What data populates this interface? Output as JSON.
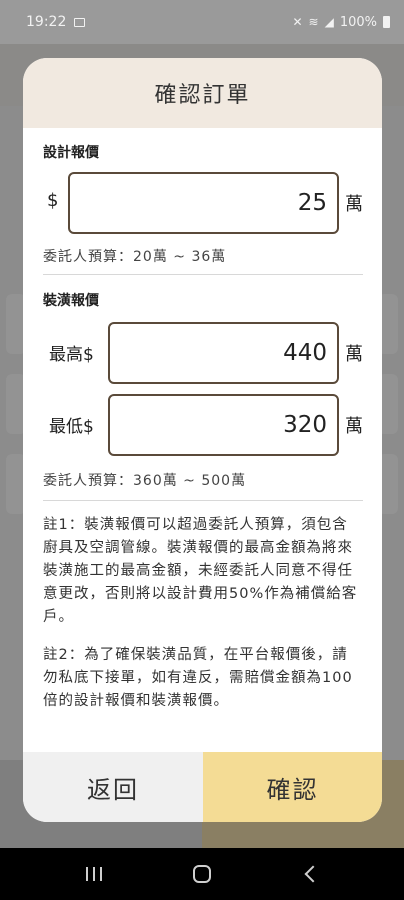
{
  "status_bar": {
    "time": "19:22",
    "battery": "100%",
    "icons": [
      "notification-icon",
      "mute-icon",
      "wifi-icon",
      "signal-icon",
      "battery-icon"
    ]
  },
  "modal": {
    "title": "確認訂單",
    "design_quote": {
      "label": "設計報價",
      "currency": "$",
      "value": "25",
      "unit": "萬",
      "budget": "委託人預算：20萬 ~ 36萬"
    },
    "renovation_quote": {
      "label": "裝潢報價",
      "max_label": "最高$",
      "max_value": "440",
      "min_label": "最低$",
      "min_value": "320",
      "unit": "萬",
      "budget": "委託人預算：360萬 ~ 500萬"
    },
    "notes": [
      "註1：裝潢報價可以超過委託人預算，須包含廚具及空調管線。裝潢報價的最高金額為將來裝潢施工的最高金額，未經委託人同意不得任意更改，否則將以設計費用50%作為補償給客戶。",
      "註2：為了確保裝潢品質，在平台報價後，請勿私底下接單，如有違反，需賠償金額為100倍的設計報價和裝潢報價。"
    ],
    "buttons": {
      "back": "返回",
      "confirm": "確認"
    }
  },
  "colors": {
    "header_bg": "#f1e9e0",
    "confirm_bg": "#f4dc95",
    "back_bg": "#f0f0f0",
    "input_border": "#5a4a3a"
  }
}
